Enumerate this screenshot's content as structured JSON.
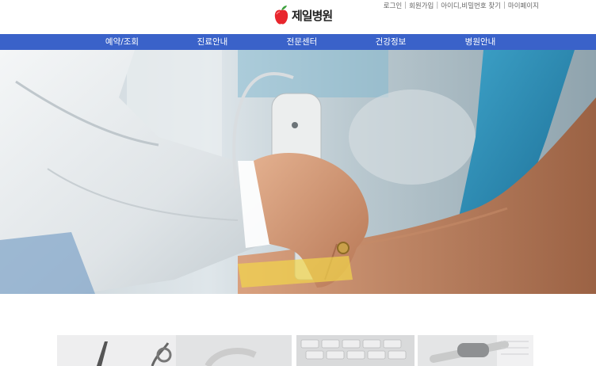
{
  "header": {
    "logo_text": "제일병원",
    "util_links": [
      "로그인",
      "회원가입",
      "아이디,비밀번호 찾기",
      "마이페이지"
    ]
  },
  "gnb": {
    "items": [
      "예약/조회",
      "진료안내",
      "전문센터",
      "건강정보",
      "병원안내"
    ]
  },
  "colors": {
    "gnb_bg": "#3a62c9",
    "logo_apple": "#e8262d",
    "logo_leaf": "#3aa13c"
  },
  "icons": {
    "logo": "apple-logo-icon"
  },
  "hero": {
    "image": "doctor-ultrasound-photo"
  },
  "thumbnails": [
    "stethoscope-thumbnail",
    "keyboard-thumbnail",
    "medical-device-thumbnail"
  ]
}
